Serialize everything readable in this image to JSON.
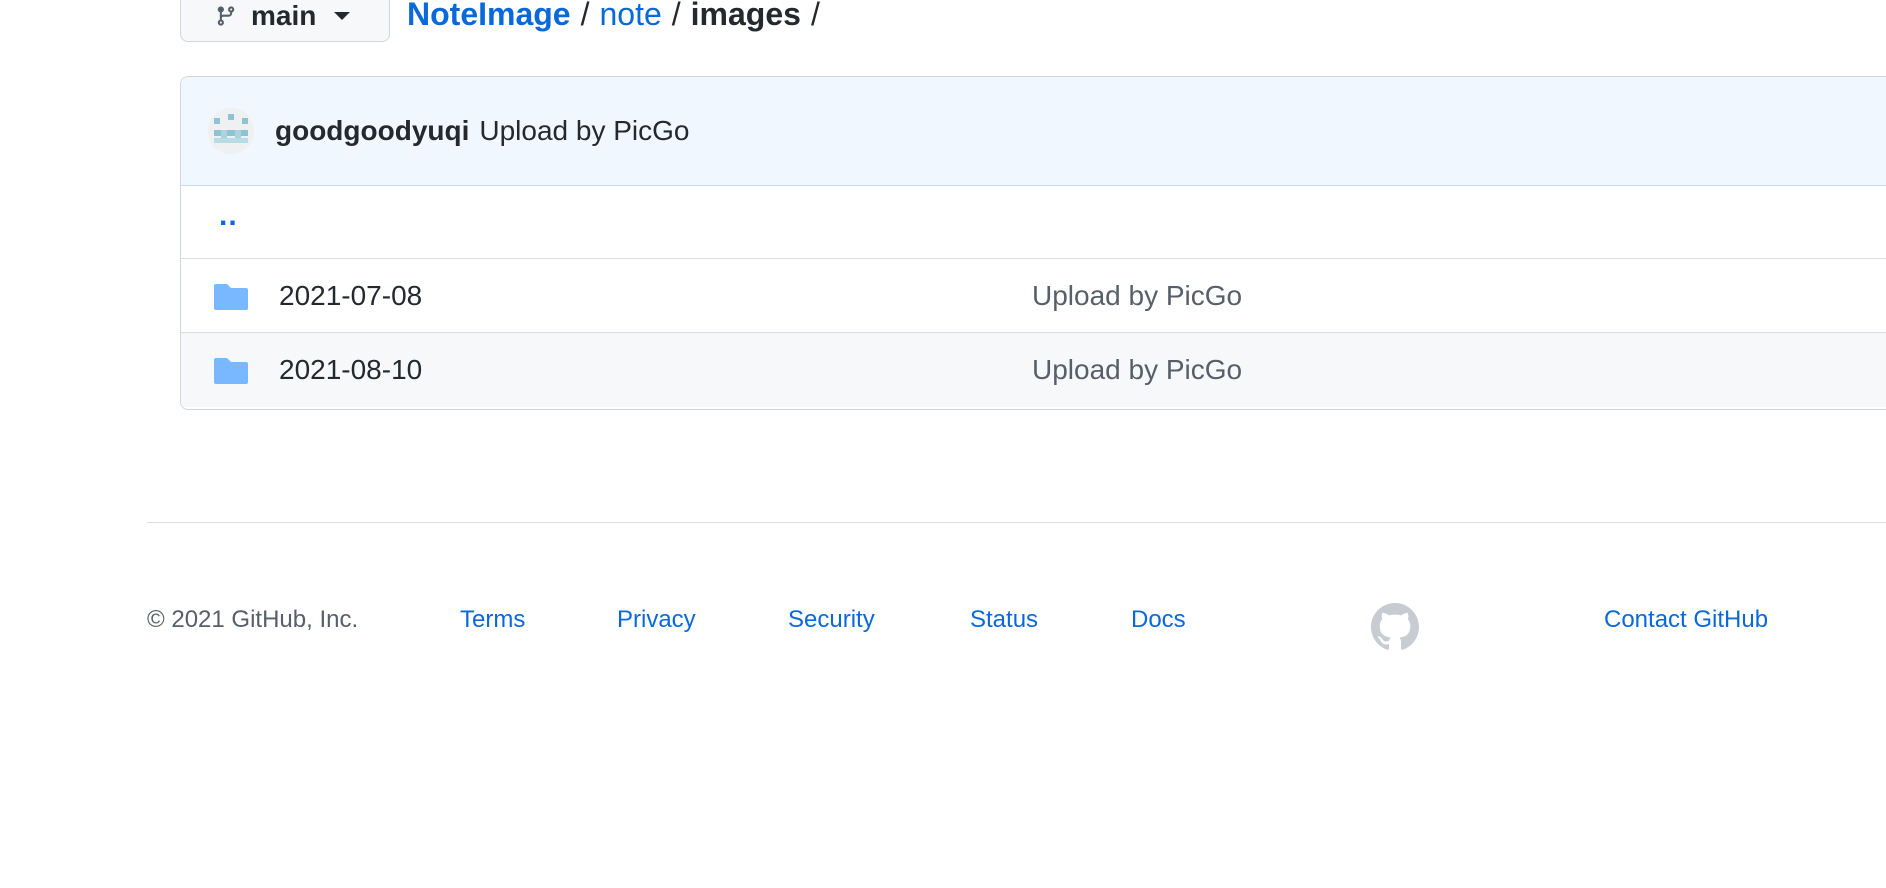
{
  "branch": {
    "name": "main",
    "icon": "git-branch-icon"
  },
  "breadcrumb": {
    "repo": "NoteImage",
    "path_link": "note",
    "current": "images",
    "separator": "/"
  },
  "commit": {
    "author": "goodgoodyuqi",
    "message": "Upload by PicGo"
  },
  "files": {
    "parent_label": "..",
    "items": [
      {
        "name": "2021-07-08",
        "commit_message": "Upload by PicGo",
        "icon": "folder-icon"
      },
      {
        "name": "2021-08-10",
        "commit_message": "Upload by PicGo",
        "icon": "folder-icon"
      }
    ]
  },
  "footer": {
    "copyright": "© 2021 GitHub, Inc.",
    "links": [
      "Terms",
      "Privacy",
      "Security",
      "Status",
      "Docs"
    ],
    "contact": "Contact GitHub",
    "logo_icon": "github-mark-icon"
  },
  "colors": {
    "link": "#0969da",
    "text": "#24292f",
    "muted": "#57606a",
    "commit_bar": "#f0f7ff",
    "folder": "#79b8ff"
  }
}
